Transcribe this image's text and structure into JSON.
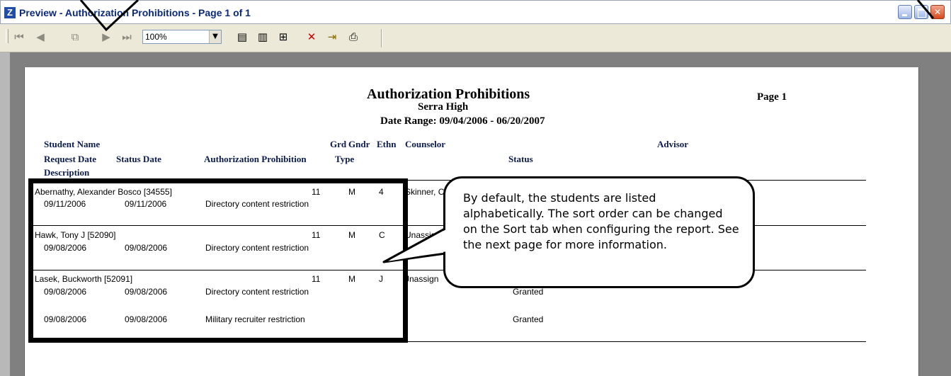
{
  "window": {
    "title": "Preview - Authorization Prohibitions - Page 1 of 1"
  },
  "toolbar": {
    "zoom_value": "100%",
    "icons": [
      "first-page-icon",
      "prev-page-icon",
      "copy-icon",
      "next-page-icon",
      "last-page-icon",
      "single-page-icon",
      "two-page-icon",
      "multi-page-icon",
      "close-preview-icon",
      "exit-icon",
      "print-icon"
    ]
  },
  "report": {
    "title": "Authorization Prohibitions",
    "school": "Serra High",
    "date_range": "Date Range: 09/04/2006 - 06/20/2007",
    "page_label": "Page 1",
    "headers": {
      "student_name": "Student Name",
      "grd": "Grd",
      "gndr": "Gndr",
      "ethn": "Ethn",
      "counselor": "Counselor",
      "advisor": "Advisor",
      "request_date": "Request Date",
      "status_date": "Status Date",
      "authorization_prohibition": "Authorization Prohibition",
      "type": "Type",
      "status": "Status",
      "description": "Description"
    },
    "students": [
      {
        "name": "Abernathy, Alexander Bosco [34555]",
        "grd": "11",
        "gndr": "M",
        "ethn": "4",
        "counselor": "Skinner, C",
        "rows": [
          {
            "request_date": "09/11/2006",
            "status_date": "09/11/2006",
            "prohibition": "Directory content restriction",
            "status": ""
          }
        ]
      },
      {
        "name": "Hawk, Tony J [52090]",
        "grd": "11",
        "gndr": "M",
        "ethn": "C",
        "counselor": "Unassig",
        "rows": [
          {
            "request_date": "09/08/2006",
            "status_date": "09/08/2006",
            "prohibition": "Directory content restriction",
            "status": ""
          }
        ]
      },
      {
        "name": "Lasek, Buckworth [52091]",
        "grd": "11",
        "gndr": "M",
        "ethn": "J",
        "counselor": "Jnassign",
        "rows": [
          {
            "request_date": "09/08/2006",
            "status_date": "09/08/2006",
            "prohibition": "Directory content restriction",
            "status": "Granted"
          },
          {
            "request_date": "09/08/2006",
            "status_date": "09/08/2006",
            "prohibition": "Military recruiter restriction",
            "status": "Granted"
          }
        ]
      }
    ]
  },
  "callout": {
    "text": "By default, the students are listed alphabetically. The sort order can be changed on the Sort tab when configuring the report. See the next page for more information."
  }
}
